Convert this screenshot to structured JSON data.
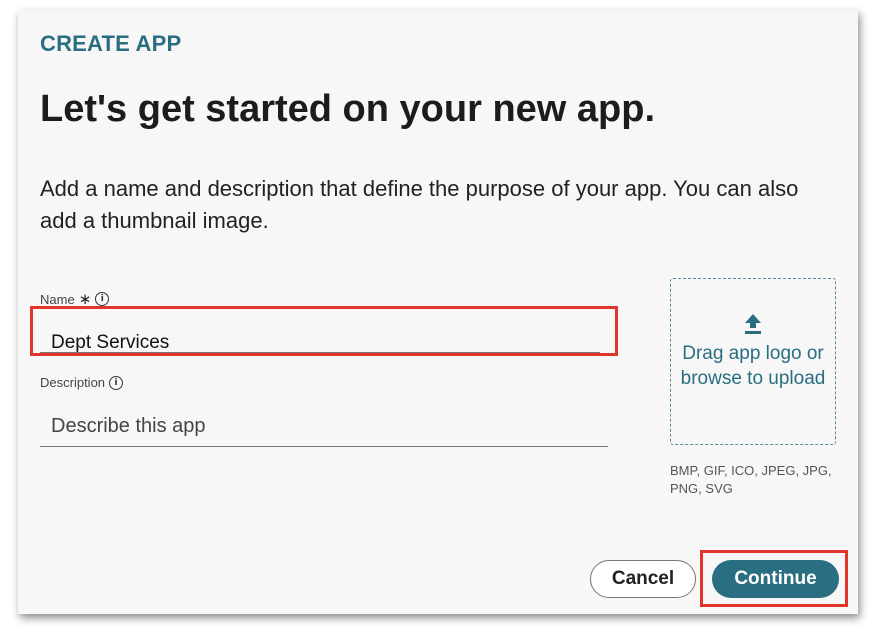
{
  "dialog": {
    "eyebrow": "CREATE APP",
    "title": "Let's get started on your new app.",
    "description": "Add a name and description that define the purpose of your app. You can also add a thumbnail image."
  },
  "form": {
    "name_label": "Name",
    "required_marker": "∗",
    "name_value": "Dept Services",
    "description_label": "Description",
    "description_placeholder": "Describe this app"
  },
  "upload": {
    "text": "Drag app logo or browse to upload",
    "formats": "BMP, GIF, ICO, JPEG, JPG, PNG, SVG",
    "icon": "upload-icon"
  },
  "actions": {
    "cancel_label": "Cancel",
    "continue_label": "Continue"
  },
  "colors": {
    "accent": "#2a6e82",
    "highlight": "#e0342c",
    "background": "#f7f7f7"
  }
}
